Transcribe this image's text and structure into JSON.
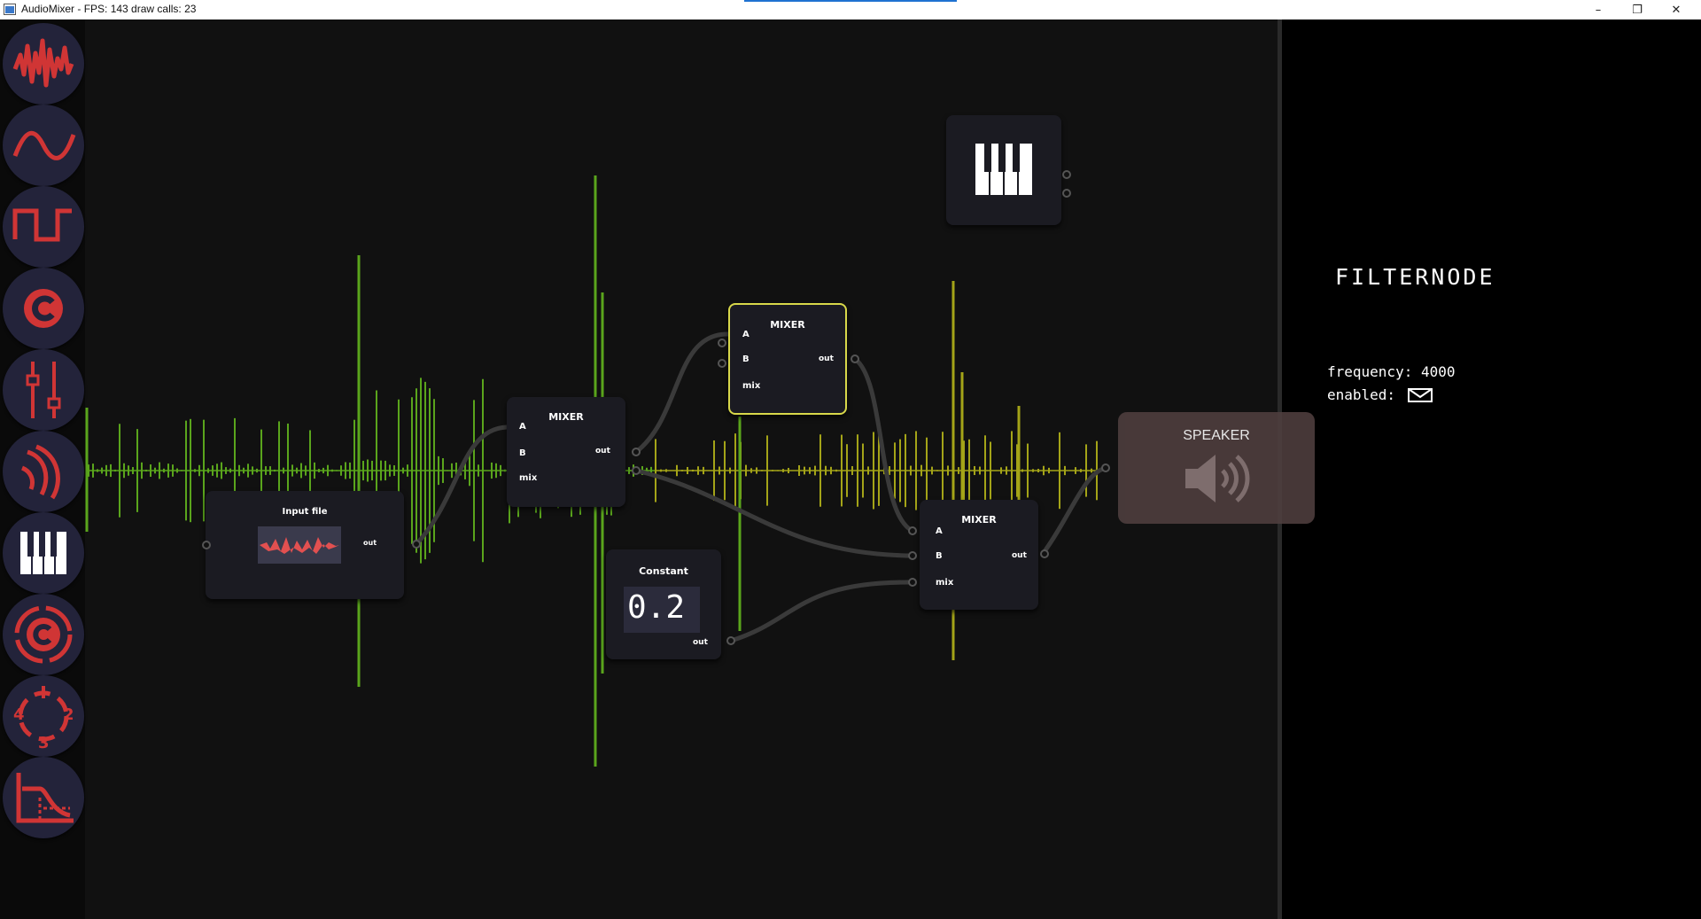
{
  "window": {
    "title": "AudioMixer - FPS: 143 draw calls: 23",
    "minimize": "–",
    "restore": "❐",
    "close": "✕"
  },
  "toolbar": {
    "tools": [
      {
        "name": "noise-tool",
        "icon": "noise-wave-icon"
      },
      {
        "name": "sine-tool",
        "icon": "sine-wave-icon"
      },
      {
        "name": "square-tool",
        "icon": "square-wave-icon"
      },
      {
        "name": "constant-tool",
        "icon": "constant-c-icon"
      },
      {
        "name": "mixer-tool",
        "icon": "sliders-icon"
      },
      {
        "name": "filter-tool",
        "icon": "ear-waves-icon"
      },
      {
        "name": "keyboard-tool",
        "icon": "piano-keys-icon"
      },
      {
        "name": "loop-tool",
        "icon": "circular-c-icon"
      },
      {
        "name": "sequencer-tool",
        "icon": "sequence-123-icon"
      },
      {
        "name": "envelope-tool",
        "icon": "envelope-graph-icon"
      }
    ],
    "accent": "#d03535",
    "bg": "#23233a"
  },
  "nodes": {
    "input_file": {
      "title": "Input file",
      "out": "out"
    },
    "mixer1": {
      "title": "MIXER",
      "a": "A",
      "b": "B",
      "mix": "mix",
      "out": "out"
    },
    "mixer2": {
      "title": "MIXER",
      "a": "A",
      "b": "B",
      "mix": "mix",
      "out": "out"
    },
    "mixer3": {
      "title": "MIXER",
      "a": "A",
      "b": "B",
      "mix": "mix",
      "out": "out"
    },
    "constant": {
      "title": "Constant",
      "value": "0.2",
      "out": "out"
    },
    "speaker": {
      "title": "SPEAKER"
    },
    "keyboard": {
      "icon": "piano-keys-icon"
    }
  },
  "inspector": {
    "title": "FILTERNODE",
    "frequency_label": "frequency:",
    "frequency_value": "4000",
    "enabled_label": "enabled:",
    "enabled": true
  },
  "colors": {
    "green_wave": "#5aa51c",
    "yellow_wave": "#a4a418",
    "selected_border": "#d8d84a",
    "node_bg": "#1b1b22",
    "speaker_bg": "#4e3e3e"
  }
}
